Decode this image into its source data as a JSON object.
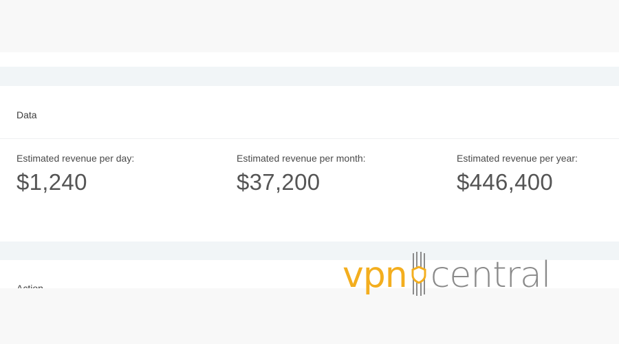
{
  "data_section": {
    "title": "Data",
    "stats": [
      {
        "label": "Estimated revenue per day:",
        "value": "$1,240"
      },
      {
        "label": "Estimated revenue per month:",
        "value": "$37,200"
      },
      {
        "label": "Estimated revenue per year:",
        "value": "$446,400"
      }
    ]
  },
  "action_section": {
    "title": "Action"
  },
  "watermark": {
    "brand_part1": "vpn",
    "brand_part2": "central",
    "color_primary": "#f3ae1f",
    "color_secondary": "#8a8a8a"
  }
}
